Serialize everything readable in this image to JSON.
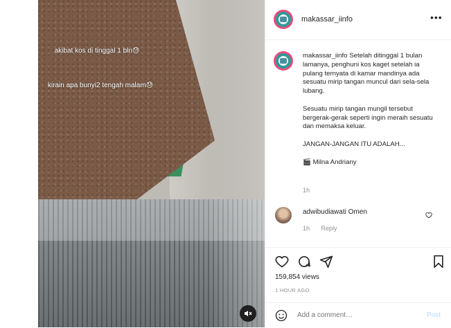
{
  "media": {
    "caption_line1": "akibat kos di tinggal 1 bln😓",
    "caption_line2": "kirain apa bunyi2 tengah malam😓"
  },
  "header": {
    "username": "makassar_iinfo",
    "more_icon": "ellipsis-icon"
  },
  "post": {
    "username": "makassar_iinfo",
    "paragraphs": [
      "Setelah ditinggal 1 bulan lamanya, penghuni kos kaget setelah ia pulang ternyata di kamar mandinya ada sesuatu mirip tangan muncul dari sela-sela lubang.",
      "Sesuatu mirip tangan mungil tersebut bergerak-gerak seperti ingin meraih sesuatu dan memaksa keluar.",
      "JANGAN-JANGAN ITU ADALAH...",
      "🎬 Milna Andriany"
    ],
    "time": "1h"
  },
  "comment": {
    "username": "adwibudiawati",
    "text": "Omen",
    "time": "1h",
    "reply_label": "Reply"
  },
  "actions": {
    "like_icon": "heart-icon",
    "comment_icon": "comment-icon",
    "share_icon": "paper-plane-icon",
    "save_icon": "bookmark-icon"
  },
  "stats": {
    "likes": "159,854 views",
    "ago": "1 HOUR AGO"
  },
  "add_comment": {
    "placeholder": "Add a comment…",
    "post_label": "Post"
  }
}
